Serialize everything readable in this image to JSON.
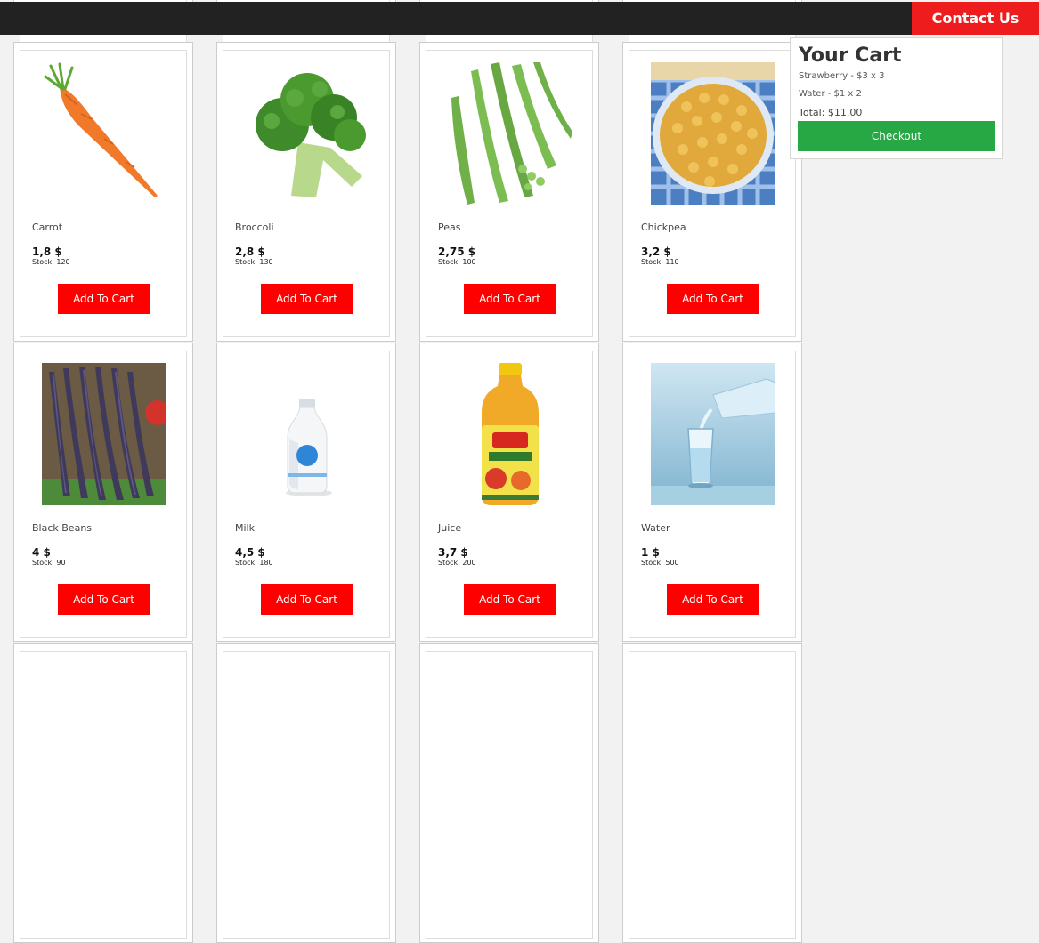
{
  "header": {
    "contact_label": "Contact Us"
  },
  "colors": {
    "add_button": "#ff0000",
    "checkout_button": "#28a745",
    "topbar": "#222222",
    "contact_button": "#ee1c1c"
  },
  "products": [
    {
      "name": "Carrot",
      "price": "1,8 $",
      "stock": "Stock: 120",
      "image": "carrot-image",
      "button": "Add To Cart"
    },
    {
      "name": "Broccoli",
      "price": "2,8 $",
      "stock": "Stock: 130",
      "image": "broccoli-image",
      "button": "Add To Cart"
    },
    {
      "name": "Peas",
      "price": "2,75 $",
      "stock": "Stock: 100",
      "image": "peas-image",
      "button": "Add To Cart"
    },
    {
      "name": "Chickpea",
      "price": "3,2 $",
      "stock": "Stock: 110",
      "image": "chickpea-image",
      "button": "Add To Cart"
    },
    {
      "name": "Black Beans",
      "price": "4 $",
      "stock": "Stock: 90",
      "image": "black-beans-image",
      "button": "Add To Cart"
    },
    {
      "name": "Milk",
      "price": "4,5 $",
      "stock": "Stock: 180",
      "image": "milk-bottle-image",
      "button": "Add To Cart"
    },
    {
      "name": "Juice",
      "price": "3,7 $",
      "stock": "Stock: 200",
      "image": "juice-bottle-image",
      "button": "Add To Cart"
    },
    {
      "name": "Water",
      "price": "1 $",
      "stock": "Stock: 500",
      "image": "water-glass-image",
      "button": "Add To Cart"
    }
  ],
  "cart": {
    "title": "Your Cart",
    "items": [
      "Strawberry - $3 x 3",
      "Water - $1 x 2"
    ],
    "total": "Total: $11.00",
    "checkout_label": "Checkout"
  }
}
